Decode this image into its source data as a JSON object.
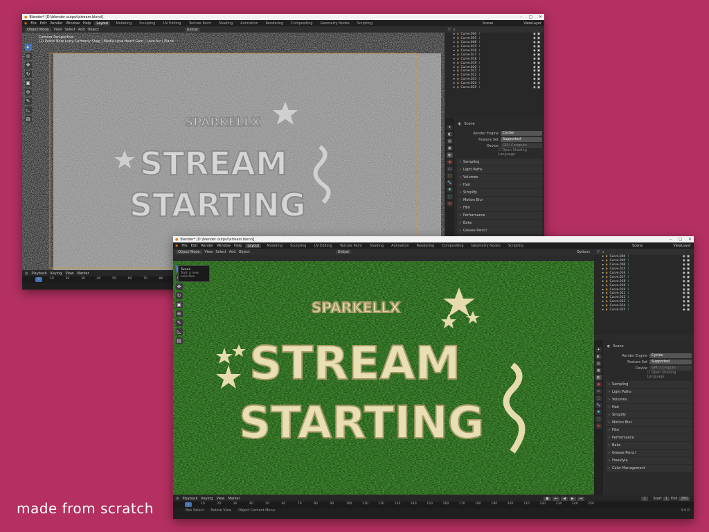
{
  "caption": "made from scratch",
  "windows": [
    {
      "title": "Blender* [D:\\blender output\\stream.blend]",
      "menu": [
        "File",
        "Edit",
        "Render",
        "Window",
        "Help"
      ],
      "workspaces": [
        "Layout",
        "Modeling",
        "Sculpting",
        "UV Editing",
        "Texture Paint",
        "Shading",
        "Animation",
        "Rendering",
        "Compositing",
        "Geometry Nodes",
        "Scripting"
      ],
      "active_ws": "Layout",
      "scene": "Scene",
      "viewlayer": "ViewLayer",
      "vp_header": {
        "mode": "Object Mode",
        "menus": [
          "View",
          "Select",
          "Add",
          "Object"
        ],
        "orient": "Global",
        "options": "Options"
      },
      "vp_info": {
        "line1": "Camera Perspective",
        "line2": "(1) Pastel Blue Ivory Cartoony Shag | Media Love Heart Gem | Love fur | Plane"
      },
      "theme": "gray",
      "outliner": [
        "Curve.004",
        "Curve.005",
        "Curve.006",
        "Curve.015",
        "Curve.016",
        "Curve.017",
        "Curve.018",
        "Curve.019",
        "Curve.020",
        "Curve.021",
        "Curve.022",
        "Curve.023",
        "Curve.024",
        "Curve.025"
      ],
      "props": {
        "scene": "Scene",
        "render_engine_label": "Render Engine",
        "render_engine": "Cycles",
        "feature_set_label": "Feature Set",
        "feature_set": "Supported",
        "device_label": "Device",
        "device": "GPU Compute",
        "osl": "Open Shading Language",
        "panels": [
          "Sampling",
          "Light Paths",
          "Volumes",
          "Hair",
          "Simplify",
          "Motion Blur",
          "Film",
          "Performance",
          "Bake",
          "Grease Pencil",
          "Freestyle"
        ]
      },
      "timeline": {
        "menus": [
          "Playback",
          "Keying",
          "View",
          "Marker"
        ],
        "ticks": [
          "10",
          "20",
          "30",
          "40",
          "50",
          "60",
          "70",
          "80"
        ],
        "current": "1"
      }
    },
    {
      "title": "Blender* [D:\\blender output\\stream.blend]",
      "menu": [
        "File",
        "Edit",
        "Render",
        "Window",
        "Help"
      ],
      "workspaces": [
        "Layout",
        "Modeling",
        "Sculpting",
        "UV Editing",
        "Texture Paint",
        "Shading",
        "Animation",
        "Rendering",
        "Compositing",
        "Geometry Nodes",
        "Scripting"
      ],
      "active_ws": "Layout",
      "scene": "Scene",
      "viewlayer": "ViewLayer",
      "vp_header": {
        "mode": "Object Mode",
        "menus": [
          "View",
          "Select",
          "Add",
          "Object"
        ],
        "orient": "Global",
        "options": "Options"
      },
      "vp_info": {
        "line1": "Camera Perspective",
        "line2": "(1) Pastel Blue Ivory Cartoony Shag | Media Love Heart Gem | Love fur | Plane"
      },
      "theme": "green",
      "outliner": [
        "Curve.004",
        "Curve.005",
        "Curve.006",
        "Curve.015",
        "Curve.016",
        "Curve.017",
        "Curve.018",
        "Curve.019",
        "Curve.020",
        "Curve.021",
        "Curve.022",
        "Curve.023",
        "Curve.024",
        "Curve.025"
      ],
      "props": {
        "scene": "Scene",
        "render_engine_label": "Render Engine",
        "render_engine": "Cycles",
        "feature_set_label": "Feature Set",
        "feature_set": "Supported",
        "device_label": "Device",
        "device": "GPU Compute",
        "osl": "Open Shading Language",
        "panels": [
          "Sampling",
          "Light Paths",
          "Volumes",
          "Hair",
          "Simplify",
          "Motion Blur",
          "Film",
          "Performance",
          "Bake",
          "Grease Pencil",
          "Freestyle",
          "Color Management"
        ]
      },
      "timeline": {
        "menus": [
          "Playback",
          "Keying",
          "View",
          "Marker"
        ],
        "ticks": [
          "10",
          "20",
          "30",
          "40",
          "50",
          "60",
          "70",
          "80",
          "90",
          "100",
          "110",
          "120",
          "130",
          "140",
          "150",
          "160",
          "170",
          "180",
          "190",
          "200",
          "210",
          "220",
          "230",
          "240",
          "250"
        ],
        "current": "1",
        "start_label": "Start",
        "start": "1",
        "end_label": "End",
        "end": "250"
      },
      "status": [
        "Box Select",
        "Rotate View",
        "Object Context Menu"
      ],
      "version": "3.0.0"
    }
  ],
  "tooltip": {
    "title": "Tweak",
    "desc": "Tool: a new selection"
  },
  "art": {
    "brand": "SPARKELLX",
    "line1": "STREAM",
    "line2": "STARTING"
  }
}
